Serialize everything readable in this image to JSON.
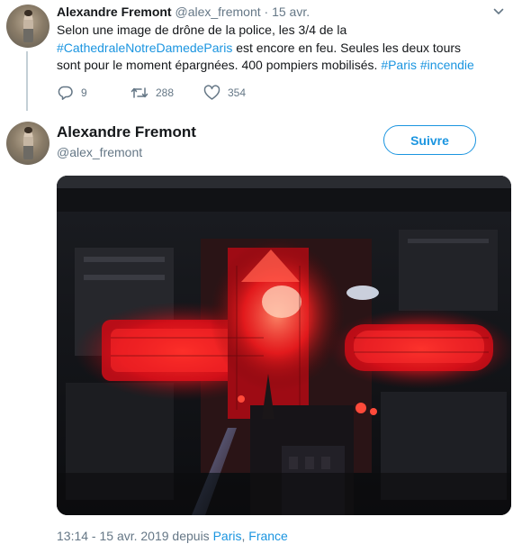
{
  "tweet1": {
    "author_name": "Alexandre Fremont",
    "author_handle": "@alex_fremont",
    "separator": "·",
    "timestamp": "15 avr.",
    "text_part1": "Selon une image de drône de la police, les 3/4 de la",
    "hashtag1": "#CathedraleNotreDamedeParis",
    "text_part2": " est encore en feu. Seules les deux tours sont pour le moment épargnées. 400 pompiers mobilisés. ",
    "hashtag2": "#Paris",
    "hashtag3": "#incendie",
    "reply_count": "9",
    "retweet_count": "288",
    "like_count": "354"
  },
  "tweet2": {
    "author_name": "Alexandre Fremont",
    "author_handle": "@alex_fremont",
    "follow_label": "Suivre",
    "footer_time": "13:14 - 15 avr. 2019 depuis ",
    "place_city": "Paris",
    "place_sep": ", ",
    "place_country": "France"
  },
  "icons": {
    "reply": "reply-icon",
    "retweet": "retweet-icon",
    "like": "heart-icon",
    "more": "chevron-down-icon"
  },
  "colors": {
    "link": "#1b95e0",
    "secondary_text": "#657786",
    "primary_text": "#14171a",
    "thread_line": "#c4cfd6"
  }
}
